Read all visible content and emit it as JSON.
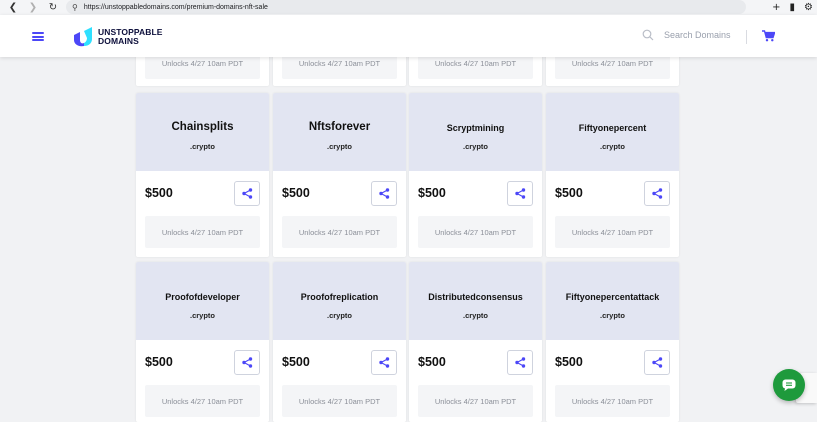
{
  "browser": {
    "url": "https://unstoppabledomains.com/premium-domains-nft-sale",
    "icons": [
      "back-icon",
      "forward-icon",
      "reload-icon",
      "search-icon",
      "new-tab-icon",
      "bookmark-icon",
      "settings-icon"
    ]
  },
  "header": {
    "brand_line1": "UNSTOPPABLE",
    "brand_line2": "DOMAINS",
    "search_placeholder": "Search Domains",
    "accent_color": "#4c47f7"
  },
  "top_row": {
    "unlock_labels": [
      "Unlocks 4/27 10am PDT",
      "Unlocks 4/27 10am PDT",
      "Unlocks 4/27 10am PDT",
      "Unlocks 4/27 10am PDT"
    ]
  },
  "cards": [
    {
      "name": "Chainsplits",
      "tld": ".crypto",
      "price": "$500",
      "unlock": "Unlocks 4/27 10am PDT",
      "size": "big"
    },
    {
      "name": "Nftsforever",
      "tld": ".crypto",
      "price": "$500",
      "unlock": "Unlocks 4/27 10am PDT",
      "size": "big"
    },
    {
      "name": "Scryptmining",
      "tld": ".crypto",
      "price": "$500",
      "unlock": "Unlocks 4/27 10am PDT",
      "size": "small"
    },
    {
      "name": "Fiftyonepercent",
      "tld": ".crypto",
      "price": "$500",
      "unlock": "Unlocks 4/27 10am PDT",
      "size": "small"
    },
    {
      "name": "Proofofdeveloper",
      "tld": ".crypto",
      "price": "$500",
      "unlock": "Unlocks 4/27 10am PDT",
      "size": "small"
    },
    {
      "name": "Proofofreplication",
      "tld": ".crypto",
      "price": "$500",
      "unlock": "Unlocks 4/27 10am PDT",
      "size": "small"
    },
    {
      "name": "Distributedconsensus",
      "tld": ".crypto",
      "price": "$500",
      "unlock": "Unlocks 4/27 10am PDT",
      "size": "small"
    },
    {
      "name": "Fiftyonepercentattack",
      "tld": ".crypto",
      "price": "$500",
      "unlock": "Unlocks 4/27 10am PDT",
      "size": "small"
    }
  ],
  "chat": {
    "icon": "chat-icon",
    "color": "#1e9a3c"
  }
}
